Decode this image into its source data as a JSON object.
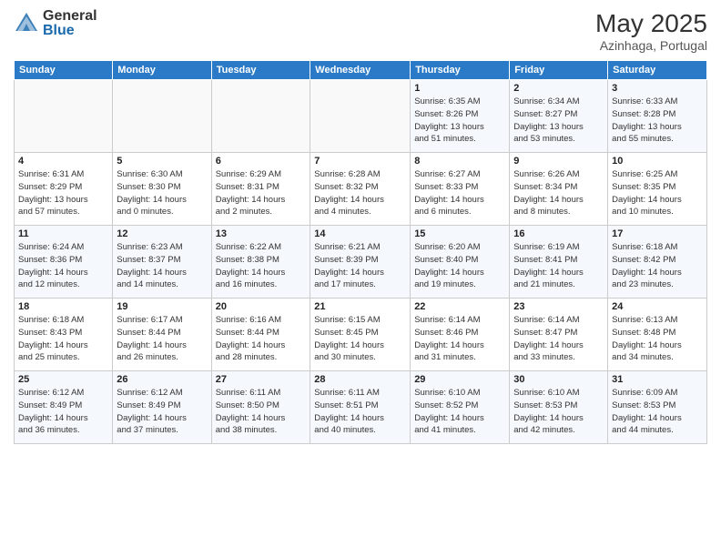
{
  "header": {
    "logo_general": "General",
    "logo_blue": "Blue",
    "month_title": "May 2025",
    "subtitle": "Azinhaga, Portugal"
  },
  "columns": [
    "Sunday",
    "Monday",
    "Tuesday",
    "Wednesday",
    "Thursday",
    "Friday",
    "Saturday"
  ],
  "rows": [
    [
      {
        "day": "",
        "info": ""
      },
      {
        "day": "",
        "info": ""
      },
      {
        "day": "",
        "info": ""
      },
      {
        "day": "",
        "info": ""
      },
      {
        "day": "1",
        "info": "Sunrise: 6:35 AM\nSunset: 8:26 PM\nDaylight: 13 hours\nand 51 minutes."
      },
      {
        "day": "2",
        "info": "Sunrise: 6:34 AM\nSunset: 8:27 PM\nDaylight: 13 hours\nand 53 minutes."
      },
      {
        "day": "3",
        "info": "Sunrise: 6:33 AM\nSunset: 8:28 PM\nDaylight: 13 hours\nand 55 minutes."
      }
    ],
    [
      {
        "day": "4",
        "info": "Sunrise: 6:31 AM\nSunset: 8:29 PM\nDaylight: 13 hours\nand 57 minutes."
      },
      {
        "day": "5",
        "info": "Sunrise: 6:30 AM\nSunset: 8:30 PM\nDaylight: 14 hours\nand 0 minutes."
      },
      {
        "day": "6",
        "info": "Sunrise: 6:29 AM\nSunset: 8:31 PM\nDaylight: 14 hours\nand 2 minutes."
      },
      {
        "day": "7",
        "info": "Sunrise: 6:28 AM\nSunset: 8:32 PM\nDaylight: 14 hours\nand 4 minutes."
      },
      {
        "day": "8",
        "info": "Sunrise: 6:27 AM\nSunset: 8:33 PM\nDaylight: 14 hours\nand 6 minutes."
      },
      {
        "day": "9",
        "info": "Sunrise: 6:26 AM\nSunset: 8:34 PM\nDaylight: 14 hours\nand 8 minutes."
      },
      {
        "day": "10",
        "info": "Sunrise: 6:25 AM\nSunset: 8:35 PM\nDaylight: 14 hours\nand 10 minutes."
      }
    ],
    [
      {
        "day": "11",
        "info": "Sunrise: 6:24 AM\nSunset: 8:36 PM\nDaylight: 14 hours\nand 12 minutes."
      },
      {
        "day": "12",
        "info": "Sunrise: 6:23 AM\nSunset: 8:37 PM\nDaylight: 14 hours\nand 14 minutes."
      },
      {
        "day": "13",
        "info": "Sunrise: 6:22 AM\nSunset: 8:38 PM\nDaylight: 14 hours\nand 16 minutes."
      },
      {
        "day": "14",
        "info": "Sunrise: 6:21 AM\nSunset: 8:39 PM\nDaylight: 14 hours\nand 17 minutes."
      },
      {
        "day": "15",
        "info": "Sunrise: 6:20 AM\nSunset: 8:40 PM\nDaylight: 14 hours\nand 19 minutes."
      },
      {
        "day": "16",
        "info": "Sunrise: 6:19 AM\nSunset: 8:41 PM\nDaylight: 14 hours\nand 21 minutes."
      },
      {
        "day": "17",
        "info": "Sunrise: 6:18 AM\nSunset: 8:42 PM\nDaylight: 14 hours\nand 23 minutes."
      }
    ],
    [
      {
        "day": "18",
        "info": "Sunrise: 6:18 AM\nSunset: 8:43 PM\nDaylight: 14 hours\nand 25 minutes."
      },
      {
        "day": "19",
        "info": "Sunrise: 6:17 AM\nSunset: 8:44 PM\nDaylight: 14 hours\nand 26 minutes."
      },
      {
        "day": "20",
        "info": "Sunrise: 6:16 AM\nSunset: 8:44 PM\nDaylight: 14 hours\nand 28 minutes."
      },
      {
        "day": "21",
        "info": "Sunrise: 6:15 AM\nSunset: 8:45 PM\nDaylight: 14 hours\nand 30 minutes."
      },
      {
        "day": "22",
        "info": "Sunrise: 6:14 AM\nSunset: 8:46 PM\nDaylight: 14 hours\nand 31 minutes."
      },
      {
        "day": "23",
        "info": "Sunrise: 6:14 AM\nSunset: 8:47 PM\nDaylight: 14 hours\nand 33 minutes."
      },
      {
        "day": "24",
        "info": "Sunrise: 6:13 AM\nSunset: 8:48 PM\nDaylight: 14 hours\nand 34 minutes."
      }
    ],
    [
      {
        "day": "25",
        "info": "Sunrise: 6:12 AM\nSunset: 8:49 PM\nDaylight: 14 hours\nand 36 minutes."
      },
      {
        "day": "26",
        "info": "Sunrise: 6:12 AM\nSunset: 8:49 PM\nDaylight: 14 hours\nand 37 minutes."
      },
      {
        "day": "27",
        "info": "Sunrise: 6:11 AM\nSunset: 8:50 PM\nDaylight: 14 hours\nand 38 minutes."
      },
      {
        "day": "28",
        "info": "Sunrise: 6:11 AM\nSunset: 8:51 PM\nDaylight: 14 hours\nand 40 minutes."
      },
      {
        "day": "29",
        "info": "Sunrise: 6:10 AM\nSunset: 8:52 PM\nDaylight: 14 hours\nand 41 minutes."
      },
      {
        "day": "30",
        "info": "Sunrise: 6:10 AM\nSunset: 8:53 PM\nDaylight: 14 hours\nand 42 minutes."
      },
      {
        "day": "31",
        "info": "Sunrise: 6:09 AM\nSunset: 8:53 PM\nDaylight: 14 hours\nand 44 minutes."
      }
    ]
  ]
}
